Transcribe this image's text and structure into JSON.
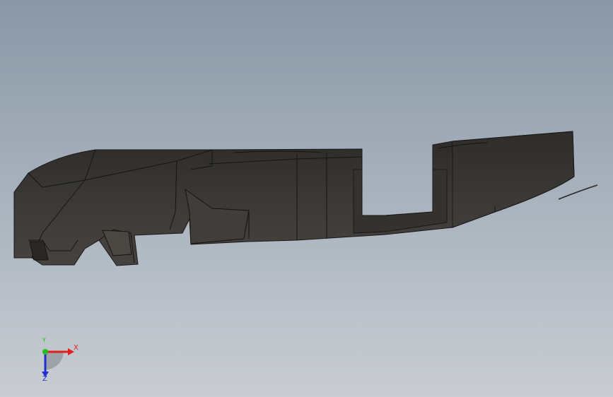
{
  "viewport": {
    "background_top": "#8a97a5",
    "background_bottom": "#c9cdd2",
    "model_color": "#3a3835",
    "edge_color": "#1a1918"
  },
  "triad": {
    "x_label": "X",
    "y_label": "Y",
    "z_label": "Z",
    "x_color": "#e02020",
    "y_color": "#20c020",
    "z_color": "#2030d0"
  }
}
